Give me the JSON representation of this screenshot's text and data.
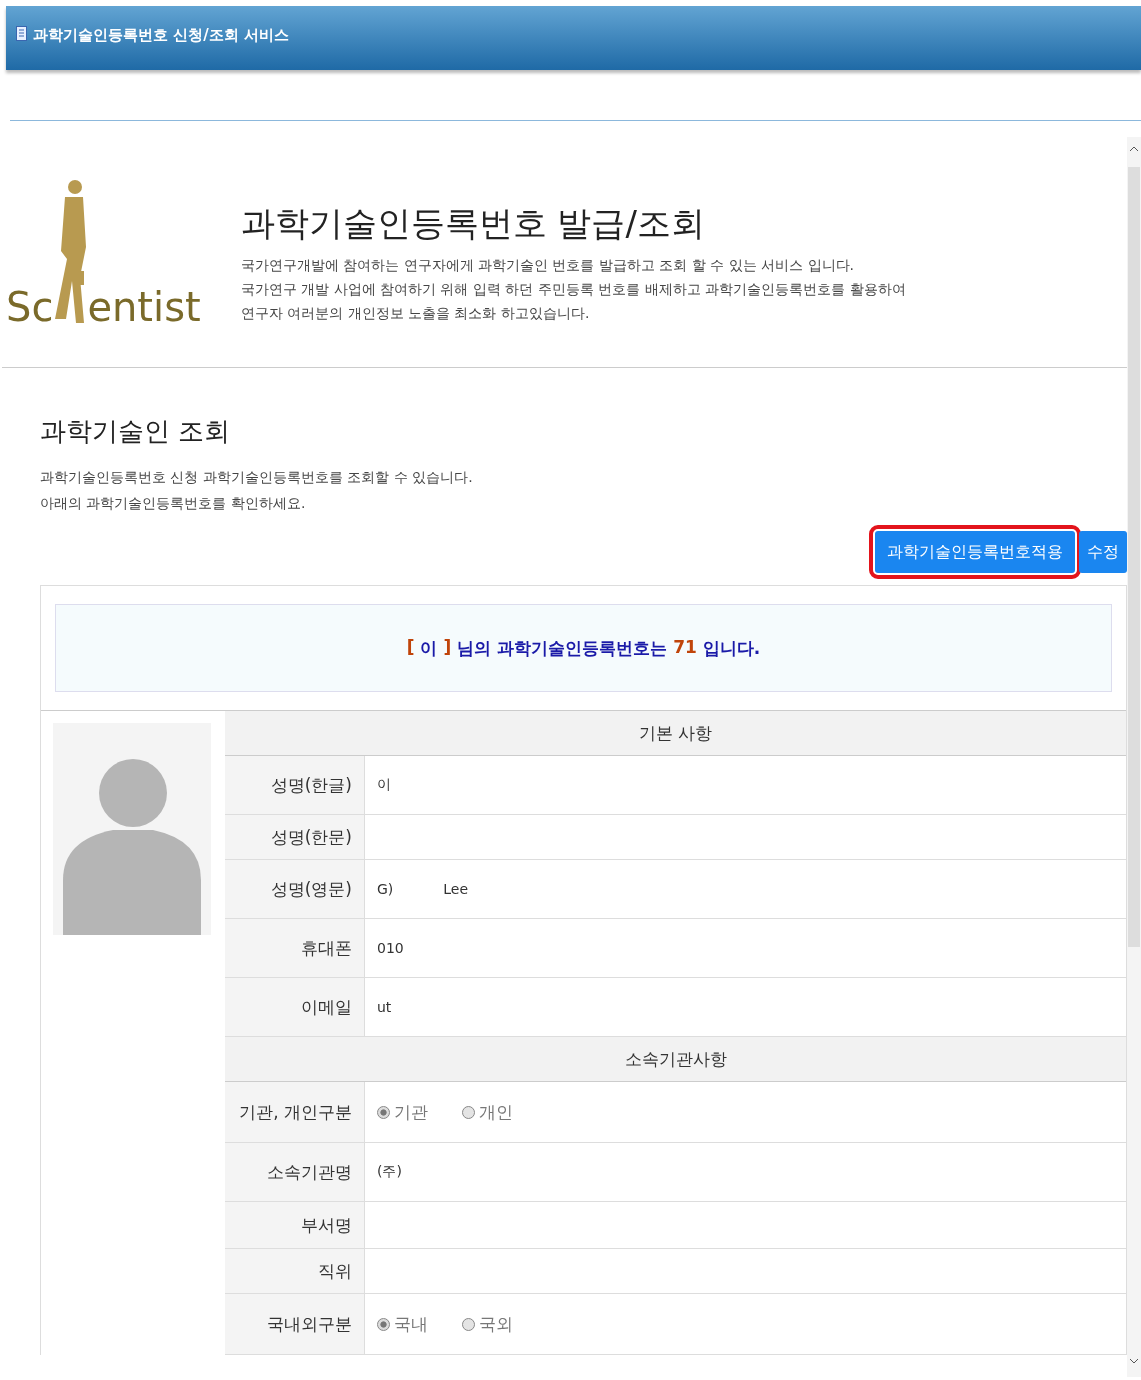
{
  "window": {
    "title": "과학기술인등록번호 신청/조회 서비스"
  },
  "logo": {
    "text_before": "Sc",
    "text_after": "entist"
  },
  "intro": {
    "title": "과학기술인등록번호 발급/조회",
    "lines": [
      "국가연구개발에 참여하는 연구자에게 과학기술인 번호를 발급하고 조회 할 수 있는 서비스 입니다.",
      "국가연구 개발 사업에 참여하기 위해 입력 하던 주민등록 번호를 배제하고 과학기술인등록번호를 활용하여",
      "연구자 여러분의 개인정보 노출을 최소화 하고있습니다."
    ]
  },
  "section": {
    "title": "과학기술인 조회",
    "lines": [
      "과학기술인등록번호 신청 과학기술인등록번호를 조회할 수 있습니다.",
      "아래의 과학기술인등록번호를 확인하세요."
    ]
  },
  "buttons": [
    {
      "label": "과학기술인등록번호적용",
      "highlighted": true
    },
    {
      "label": "수정",
      "highlighted": false
    }
  ],
  "message": [
    {
      "text": "[",
      "kind": "accent"
    },
    {
      "text": "이",
      "kind": "plain"
    },
    {
      "text": "]",
      "kind": "accent"
    },
    {
      "text": "님의 과학기술인등록번호는",
      "kind": "plain"
    },
    {
      "text": "71",
      "kind": "accent"
    },
    {
      "text": "입니다.",
      "kind": "plain"
    }
  ],
  "groups": [
    {
      "title": "기본 사항",
      "rows": [
        {
          "label": "성명(한글)",
          "kind": "text",
          "values": [
            "이"
          ]
        },
        {
          "label": "성명(한문)",
          "kind": "text",
          "values": []
        },
        {
          "label": "성명(영문)",
          "kind": "text",
          "values": [
            "G)",
            "Lee"
          ]
        },
        {
          "label": "휴대폰",
          "kind": "text",
          "values": [
            "010"
          ]
        },
        {
          "label": "이메일",
          "kind": "text",
          "values": [
            "ut"
          ]
        }
      ]
    },
    {
      "title": "소속기관사항",
      "rows": [
        {
          "label": "기관, 개인구분",
          "kind": "radio",
          "options": [
            {
              "label": "기관",
              "selected": true
            },
            {
              "label": "개인",
              "selected": false
            }
          ]
        },
        {
          "label": "소속기관명",
          "kind": "text",
          "values": [
            "(주)"
          ]
        },
        {
          "label": "부서명",
          "kind": "text",
          "values": []
        },
        {
          "label": "직위",
          "kind": "text",
          "values": []
        },
        {
          "label": "국내외구분",
          "kind": "radio",
          "options": [
            {
              "label": "국내",
              "selected": true
            },
            {
              "label": "국외",
              "selected": false
            }
          ]
        }
      ]
    }
  ]
}
